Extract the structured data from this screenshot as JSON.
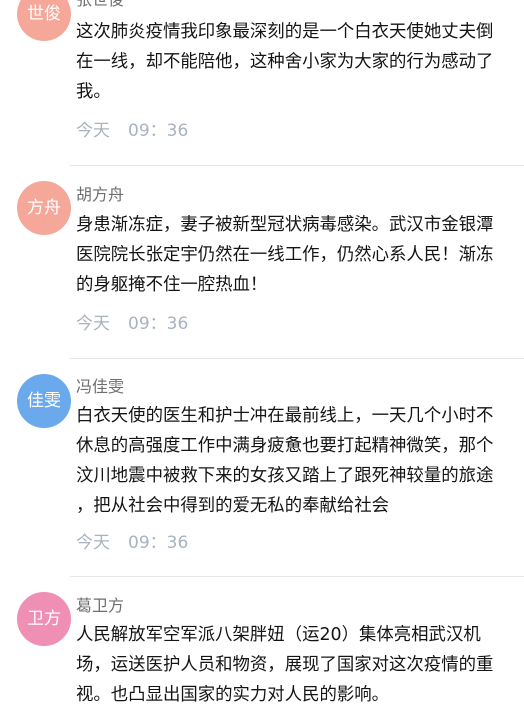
{
  "comments": [
    {
      "avatar_text": "世俊",
      "avatar_color": "#f5a79a",
      "name": "张世俊",
      "lines": [
        "这次肺炎疫情我印象最深刻的是一个白衣天使她丈夫倒",
        "在一线，却不能陪他，这种舍小家为大家的行为感动了",
        "我。"
      ],
      "date": "今天",
      "time": "09：36"
    },
    {
      "avatar_text": "方舟",
      "avatar_color": "#f5a79a",
      "name": "胡方舟",
      "lines": [
        "身患渐冻症，妻子被新型冠状病毒感染。武汉市金银潭",
        "医院院长张定宇仍然在一线工作，仍然心系人民！渐冻",
        "的身躯掩不住一腔热血！"
      ],
      "date": "今天",
      "time": "09：36"
    },
    {
      "avatar_text": "佳雯",
      "avatar_color": "#69a9ec",
      "name": "冯佳雯",
      "lines": [
        "白衣天使的医生和护士冲在最前线上，一天几个小时不",
        "休息的高强度工作中满身疲惫也要打起精神微笑，那个",
        "汶川地震中被救下来的女孩又踏上了跟死神较量的旅途",
        "，把从社会中得到的爱无私的奉献给社会"
      ],
      "date": "今天",
      "time": "09：36"
    },
    {
      "avatar_text": "卫方",
      "avatar_color": "#ef8fb4",
      "name": "葛卫方",
      "lines": [
        "人民解放军空军派八架胖妞（运20）集体亮相武汉机",
        "场，运送医护人员和物资，展现了国家对这次疫情的重",
        "视。也凸显出国家的实力对人民的影响。"
      ]
    }
  ]
}
